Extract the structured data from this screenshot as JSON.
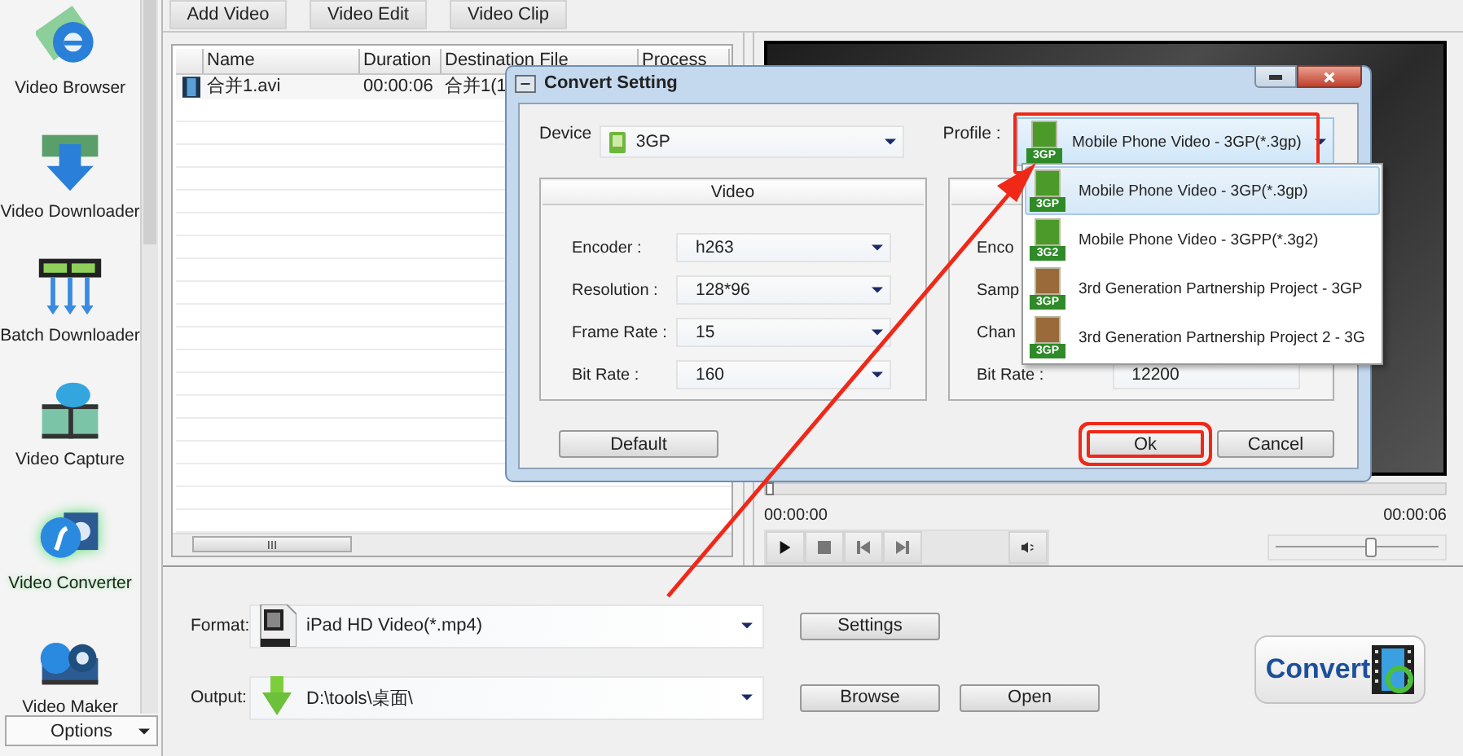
{
  "sidebar": {
    "items": [
      {
        "label": "Video Browser",
        "selected": false
      },
      {
        "label": "Video Downloader",
        "selected": false
      },
      {
        "label": "Batch Downloader",
        "selected": false
      },
      {
        "label": "Video Capture",
        "selected": false
      },
      {
        "label": "Video Converter",
        "selected": true
      },
      {
        "label": "Video Maker",
        "selected": false
      }
    ],
    "options": "Options"
  },
  "toolbar": [
    "Add Video",
    "Video Edit",
    "Video Clip"
  ],
  "file_table": {
    "columns": [
      "Name",
      "Duration",
      "Destination File",
      "Process"
    ],
    "rows": [
      {
        "name": "合并1.avi",
        "duration": "00:00:06",
        "destination": "合并1(1"
      }
    ]
  },
  "player": {
    "seek": {
      "level": 0
    },
    "time_start": "00:00:00",
    "time_end": "00:00:06",
    "volume": {
      "level": 0.58
    }
  },
  "format": {
    "label": "Format:",
    "value": "iPad HD Video(*.mp4)"
  },
  "output": {
    "label": "Output:",
    "value": "D:\\tools\\桌面\\"
  },
  "buttons": {
    "settings": "Settings",
    "browse": "Browse",
    "open": "Open",
    "convert": "Convert"
  },
  "dialog": {
    "title": "Convert Setting",
    "device": {
      "label": "Device",
      "value": "3GP"
    },
    "profile": {
      "label": "Profile :",
      "value": "Mobile Phone Video - 3GP(*.3gp)",
      "badge": "3GP",
      "highlighted": true
    },
    "video_group": {
      "title": "Video",
      "fields": [
        {
          "label": "Encoder :",
          "value": "h263"
        },
        {
          "label": "Resolution :",
          "value": "128*96"
        },
        {
          "label": "Frame Rate :",
          "value": "15"
        },
        {
          "label": "Bit Rate :",
          "value": "160"
        }
      ]
    },
    "audio_group": {
      "fields": [
        {
          "label": "Enco"
        },
        {
          "label": "Samp"
        },
        {
          "label": "Chan"
        },
        {
          "label": "Bit Rate :",
          "value": "12200"
        }
      ]
    },
    "profile_options": [
      {
        "label": "Mobile Phone Video - 3GP(*.3gp)",
        "badge": "3GP",
        "color": "#4c9a2a",
        "selected": true
      },
      {
        "label": "Mobile Phone Video - 3GPP(*.3g2)",
        "badge": "3G2",
        "color": "#4c9a2a",
        "selected": false
      },
      {
        "label": "3rd Generation Partnership Project - 3GP",
        "badge": "3GP",
        "color": "#9a6a3a",
        "selected": false
      },
      {
        "label": "3rd Generation Partnership Project 2 - 3G",
        "badge": "3GP",
        "color": "#9a6a3a",
        "selected": false
      }
    ],
    "buttons": [
      {
        "label": "Default",
        "kind": "default",
        "highlighted": false
      },
      {
        "label": "Ok",
        "kind": "ok",
        "highlighted": true
      },
      {
        "label": "Cancel",
        "kind": "cancel",
        "highlighted": false
      }
    ]
  }
}
